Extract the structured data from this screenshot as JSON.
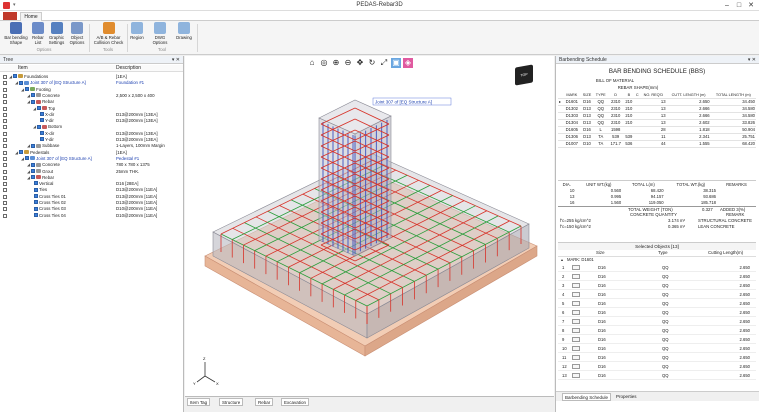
{
  "window": {
    "title": "PEDAS-Rebar3D",
    "minimize": "–",
    "maximize": "□",
    "close": "✕"
  },
  "ribbon": {
    "tab": "Home",
    "buttons": [
      {
        "label1": "Bar bending",
        "label2": "Shape",
        "color": "#4a6fb5"
      },
      {
        "label1": "Rebar",
        "label2": "List",
        "color": "#6c8cc8"
      },
      {
        "label1": "Graphic",
        "label2": "Settings",
        "color": "#5580c0"
      },
      {
        "label1": "Object",
        "label2": "Options",
        "color": "#7a98c9"
      },
      {
        "label1": "A/B & Rebar",
        "label2": "Collision Check",
        "color": "#e08c2e"
      },
      {
        "label1": "Region",
        "label2": "",
        "color": "#8fb4dd"
      },
      {
        "label1": "DWG Options",
        "label2": "",
        "color": "#8fb4dd"
      },
      {
        "label1": "Drawing",
        "label2": "",
        "color": "#8fb4dd"
      }
    ],
    "groups": [
      "Options",
      "Tools",
      "Tool"
    ]
  },
  "tree": {
    "title": "Tree",
    "pin": "▾ ✕",
    "header": {
      "item": "Item",
      "desc": "Description"
    },
    "rows": [
      {
        "indent": 0,
        "label": "Foundations",
        "desc": "[1EA]",
        "blue": false,
        "icon": "#c79b3b"
      },
      {
        "indent": 1,
        "label": "Joint 307 of [EQ Structure A]",
        "desc": "Foundation #1",
        "blue": true,
        "icon": "#5b8fd6"
      },
      {
        "indent": 2,
        "label": "Footing",
        "desc": "",
        "blue": false,
        "icon": "#7aa95c"
      },
      {
        "indent": 3,
        "label": "Concrete",
        "desc": "2,500 x 2,500 x 400",
        "blue": false,
        "icon": "#9a9a9a"
      },
      {
        "indent": 3,
        "label": "Rebar",
        "desc": "",
        "blue": false,
        "icon": "#c65a5a"
      },
      {
        "indent": 4,
        "label": "Top",
        "desc": "",
        "blue": false,
        "icon": "#c65a5a"
      },
      {
        "indent": 5,
        "label": "X-dir",
        "desc": "D13@200mm [13EA]",
        "blue": false,
        "icon": ""
      },
      {
        "indent": 5,
        "label": "Y-dir",
        "desc": "D13@200mm [13EA]",
        "blue": false,
        "icon": ""
      },
      {
        "indent": 4,
        "label": "Bottom",
        "desc": "",
        "blue": false,
        "icon": "#c65a5a"
      },
      {
        "indent": 5,
        "label": "X-dir",
        "desc": "D13@200mm [13EA]",
        "blue": false,
        "icon": ""
      },
      {
        "indent": 5,
        "label": "Y-dir",
        "desc": "D13@200mm [13EA]",
        "blue": false,
        "icon": ""
      },
      {
        "indent": 3,
        "label": "Subbase",
        "desc": "1-Layers, 100mm Margin",
        "blue": false,
        "icon": "#9a9a9a"
      },
      {
        "indent": 1,
        "label": "Pedestals",
        "desc": "[1EA]",
        "blue": false,
        "icon": "#c79b3b"
      },
      {
        "indent": 2,
        "label": "Joint 307 of [EQ Structure A]",
        "desc": "Pedestal #1",
        "blue": true,
        "icon": "#5b8fd6"
      },
      {
        "indent": 3,
        "label": "Concrete",
        "desc": "780 x 780 x 1375",
        "blue": false,
        "icon": "#9a9a9a"
      },
      {
        "indent": 3,
        "label": "Grout",
        "desc": "25mm THK.",
        "blue": false,
        "icon": "#9a9a9a"
      },
      {
        "indent": 3,
        "label": "Rebar",
        "desc": "",
        "blue": false,
        "icon": "#c65a5a"
      },
      {
        "indent": 4,
        "label": "Vertical",
        "desc": "D16 [28EA]",
        "blue": false,
        "icon": ""
      },
      {
        "indent": 4,
        "label": "Ties",
        "desc": "D13@200mm [11EA]",
        "blue": false,
        "icon": ""
      },
      {
        "indent": 4,
        "label": "Cross Ties 01",
        "desc": "D13@200mm [11EA]",
        "blue": false,
        "icon": ""
      },
      {
        "indent": 4,
        "label": "Cross Ties 02",
        "desc": "D13@200mm [11EA]",
        "blue": false,
        "icon": ""
      },
      {
        "indent": 4,
        "label": "Cross Ties 03",
        "desc": "D10@200mm [11EA]",
        "blue": false,
        "icon": ""
      },
      {
        "indent": 4,
        "label": "Cross Ties 04",
        "desc": "D10@200mm [11EA]",
        "blue": false,
        "icon": ""
      }
    ]
  },
  "viewport": {
    "tag": "Joint 307 of [EQ Structure A]",
    "tools": [
      "⌂",
      "◎",
      "⊕",
      "⊖",
      "✥",
      "↻",
      "⤢",
      "▣",
      "◈"
    ],
    "cube": "TOP"
  },
  "bottom_tabs": [
    "Item Tag",
    "Structure",
    "Rebar",
    "Excavation"
  ],
  "bbs": {
    "panel_title": "Barbending Schedule",
    "title": "BAR BENDING SCHEDULE (BBS)",
    "bom": "BILL OF MATERIAL",
    "shape_hdr": "REBAR SHAPE(mm)",
    "cols": [
      "MARK",
      "SIZE",
      "TYPE",
      "D",
      "B",
      "C",
      "NO. REQ'D",
      "CUTT. LENGTH (m)",
      "TOTAL LENGTH (m)"
    ],
    "rows": [
      [
        "D1601",
        "D16",
        "QQ",
        "2310",
        "210",
        "",
        "13",
        "2.650",
        "34.450"
      ],
      [
        "D1302",
        "D13",
        "QQ",
        "2310",
        "210",
        "",
        "13",
        "2.666",
        "34.580"
      ],
      [
        "D1303",
        "D13",
        "QQ",
        "2310",
        "210",
        "",
        "13",
        "2.666",
        "34.580"
      ],
      [
        "D1304",
        "D13",
        "QQ",
        "2310",
        "210",
        "",
        "13",
        "2.602",
        "33.826"
      ],
      [
        "D1605",
        "D16",
        "L",
        "1598",
        "",
        "",
        "28",
        "1.818",
        "50.904"
      ],
      [
        "D1306",
        "D13",
        "TA",
        "539",
        "539",
        "",
        "11",
        "2.341",
        "25.751"
      ],
      [
        "D1007",
        "D10",
        "TA",
        "171.7",
        "536",
        "",
        "44",
        "1.555",
        "68.420"
      ]
    ],
    "sum_cols": [
      "DIA.",
      "UNIT WT.(kg)",
      "TOTAL L(m)",
      "TOTAL WT.(kg)",
      "REMARKS"
    ],
    "sum_rows": [
      [
        "10",
        "0.560",
        "68.420",
        "38.315",
        ""
      ],
      [
        "13",
        "0.995",
        "94.157",
        "93.686",
        ""
      ],
      [
        "16",
        "1.560",
        "119.050",
        "185.718",
        ""
      ]
    ],
    "total_label": "TOTAL WEIGHT (TON)",
    "total_value": "0.327",
    "added": "ADDED 3(%)",
    "concrete_hdr": "CONCRETE QUANTITY",
    "remark_hdr": "REMARK",
    "concrete_rows": [
      [
        "f'c=255 kg/cm^2",
        "3.174 m³",
        "STRUCTURAL CONCRETE"
      ],
      [
        "f'c=150 kg/cm^2",
        "0.365 m³",
        "LEAN CONCRETE"
      ]
    ]
  },
  "selected": {
    "title": "Selected Objects [13]",
    "cols": [
      "Size",
      "Type",
      "Cutting Length(m)"
    ],
    "group": "MARK: D1601",
    "rows": [
      [
        "1",
        "D16",
        "QQ",
        "2.650"
      ],
      [
        "2",
        "D16",
        "QQ",
        "2.650"
      ],
      [
        "3",
        "D16",
        "QQ",
        "2.650"
      ],
      [
        "4",
        "D16",
        "QQ",
        "2.650"
      ],
      [
        "5",
        "D16",
        "QQ",
        "2.650"
      ],
      [
        "6",
        "D16",
        "QQ",
        "2.650"
      ],
      [
        "7",
        "D16",
        "QQ",
        "2.650"
      ],
      [
        "8",
        "D16",
        "QQ",
        "2.650"
      ],
      [
        "9",
        "D16",
        "QQ",
        "2.650"
      ],
      [
        "10",
        "D16",
        "QQ",
        "2.650"
      ],
      [
        "11",
        "D16",
        "QQ",
        "2.650"
      ],
      [
        "12",
        "D16",
        "QQ",
        "2.650"
      ],
      [
        "13",
        "D16",
        "QQ",
        "2.650"
      ]
    ]
  },
  "right_tabs": [
    "Barbending Schedule",
    "Properties"
  ]
}
